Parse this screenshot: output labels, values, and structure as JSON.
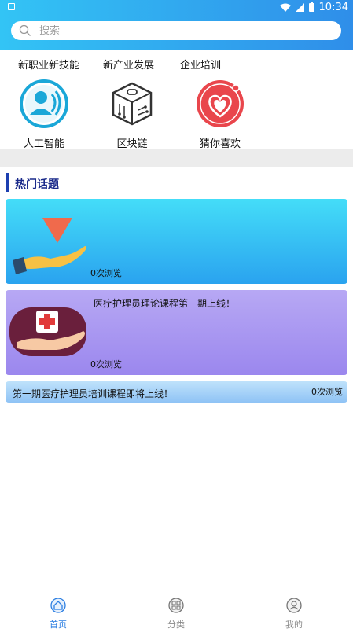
{
  "status_bar": {
    "time": "10:34"
  },
  "search": {
    "placeholder": "搜索"
  },
  "tabs": [
    {
      "label": "新职业新技能"
    },
    {
      "label": "新产业发展"
    },
    {
      "label": "企业培训"
    }
  ],
  "categories": [
    {
      "label": "人工智能",
      "icon": "ai-person-icon"
    },
    {
      "label": "区块链",
      "icon": "blockchain-cube-icon"
    },
    {
      "label": "猜你喜欢",
      "icon": "heart-icon"
    }
  ],
  "section": {
    "title": "热门话题"
  },
  "topics": [
    {
      "title": "",
      "views": "0次浏览",
      "icon": "hand-heart-icon"
    },
    {
      "title": "医疗护理员理论课程第一期上线！",
      "views": "0次浏览",
      "icon": "hand-medical-icon"
    },
    {
      "title": "第一期医疗护理员培训课程即将上线！",
      "views": "0次浏览"
    }
  ],
  "bottom_nav": [
    {
      "label": "首页",
      "icon": "home-icon",
      "active": true
    },
    {
      "label": "分类",
      "icon": "category-icon",
      "active": false
    },
    {
      "label": "我的",
      "icon": "profile-icon",
      "active": false
    }
  ],
  "colors": {
    "header_start": "#33c4f5",
    "header_end": "#2f8ee9",
    "accent": "#2d7fe2",
    "section_bar": "#1d3fb0"
  }
}
